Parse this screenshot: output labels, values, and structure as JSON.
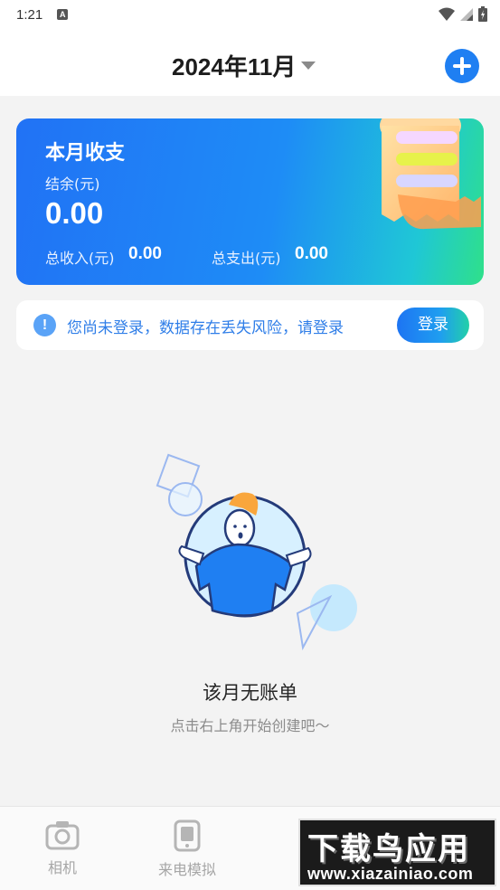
{
  "status_bar": {
    "time": "1:21",
    "notification_icon": "A"
  },
  "header": {
    "month": "2024年11月",
    "add_icon": "plus-circle-icon"
  },
  "summary": {
    "title": "本月收支",
    "balance_label": "结余(元)",
    "balance_value": "0.00",
    "income_label": "总收入(元)",
    "income_value": "0.00",
    "expense_label": "总支出(元)",
    "expense_value": "0.00"
  },
  "login_banner": {
    "icon": "!",
    "message": "您尚未登录，数据存在丢失风险，请登录",
    "button_label": "登录"
  },
  "empty_state": {
    "title": "该月无账单",
    "hint": "点击右上角开始创建吧～"
  },
  "bottom_nav": {
    "items": [
      {
        "label": "相机",
        "icon": "camera-icon"
      },
      {
        "label": "来电模拟",
        "icon": "phone-icon"
      },
      {
        "label": "",
        "icon": "tool-icon"
      },
      {
        "label": "",
        "icon": "ledger-icon"
      }
    ]
  },
  "watermark": {
    "main": "下载鸟应用",
    "url": "www.xiazainiao.com"
  },
  "colors": {
    "accent": "#1f7ff2",
    "page_background": "#f3f3f3"
  }
}
